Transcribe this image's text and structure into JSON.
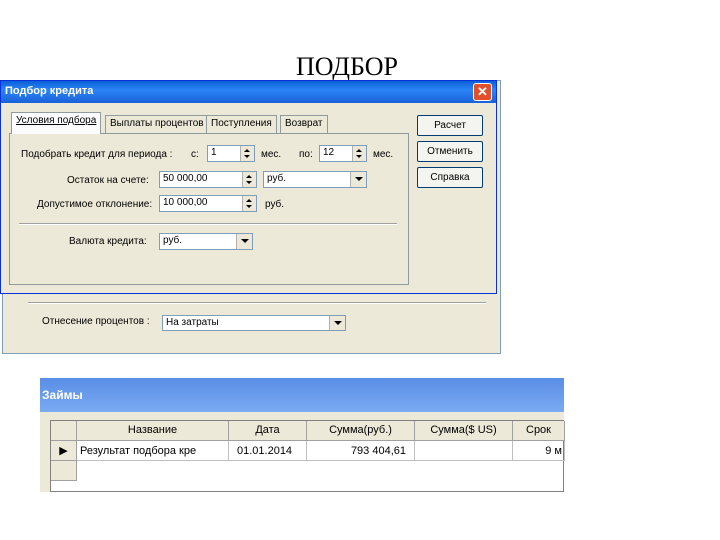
{
  "slide": {
    "title": "ПОДБОР"
  },
  "back_window": {
    "interest_label": "Отнесение процентов :",
    "interest_value": "На затраты"
  },
  "dialog": {
    "title": "Подбор кредита",
    "close_symbol": "✕",
    "tabs": [
      "Условия подбора",
      "Выплаты процентов",
      "Поступления",
      "Возврат"
    ],
    "period_label": "Подобрать кредит для периода :",
    "from_label": "с:",
    "from_value": "1",
    "months_label_1": "мес.",
    "to_label": "по:",
    "to_value": "12",
    "months_label_2": "мес.",
    "balance_label": "Остаток на счете:",
    "balance_value": "50 000,00",
    "balance_currency": "руб.",
    "deviation_label": "Допустимое отклонение:",
    "deviation_value": "10 000,00",
    "deviation_currency": "руб.",
    "loan_currency_label": "Валюта кредита:",
    "loan_currency_value": "руб.",
    "buttons": {
      "calc": "Расчет",
      "cancel": "Отменить",
      "help": "Справка"
    }
  },
  "loans": {
    "title": "Займы",
    "columns": [
      "Название",
      "Дата",
      "Сумма(руб.)",
      "Сумма($ US)",
      "Срок"
    ],
    "row": {
      "indicator": "▶",
      "name": "Результат подбора кре",
      "date": "01.01.2014",
      "sum_rub": "793 404,61",
      "sum_usd": "",
      "term": "9 м"
    }
  }
}
